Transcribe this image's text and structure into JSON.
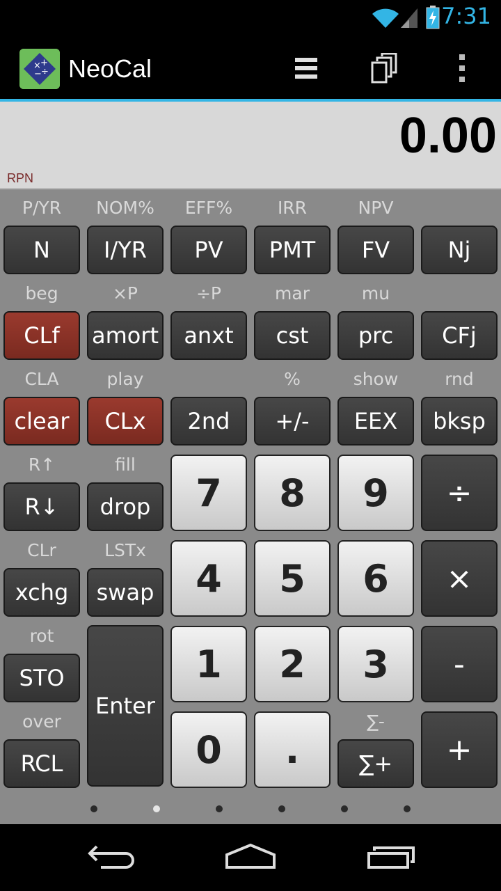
{
  "status_bar": {
    "time": "7:31"
  },
  "action_bar": {
    "title": "NeoCal"
  },
  "display": {
    "value": "0.00",
    "mode": "RPN"
  },
  "keys": [
    {
      "id": "n",
      "label": "N",
      "sub": "P/YR",
      "style": "dark"
    },
    {
      "id": "iyr",
      "label": "I/YR",
      "sub": "NOM%",
      "style": "dark"
    },
    {
      "id": "pv",
      "label": "PV",
      "sub": "EFF%",
      "style": "dark"
    },
    {
      "id": "pmt",
      "label": "PMT",
      "sub": "IRR",
      "style": "dark"
    },
    {
      "id": "fv",
      "label": "FV",
      "sub": "NPV",
      "style": "dark"
    },
    {
      "id": "nj",
      "label": "Nj",
      "sub": "",
      "style": "dark"
    },
    {
      "id": "clf",
      "label": "CLf",
      "sub": "beg",
      "style": "red"
    },
    {
      "id": "amort",
      "label": "amort",
      "sub": "×P",
      "style": "dark"
    },
    {
      "id": "anxt",
      "label": "anxt",
      "sub": "÷P",
      "style": "dark"
    },
    {
      "id": "cst",
      "label": "cst",
      "sub": "mar",
      "style": "dark"
    },
    {
      "id": "prc",
      "label": "prc",
      "sub": "mu",
      "style": "dark"
    },
    {
      "id": "cfj",
      "label": "CFj",
      "sub": "",
      "style": "dark"
    },
    {
      "id": "clear",
      "label": "clear",
      "sub": "CLA",
      "style": "red"
    },
    {
      "id": "clx",
      "label": "CLx",
      "sub": "play",
      "style": "red"
    },
    {
      "id": "2nd",
      "label": "2nd",
      "sub": "",
      "style": "dark"
    },
    {
      "id": "chs",
      "label": "+/-",
      "sub": "%",
      "style": "dark"
    },
    {
      "id": "eex",
      "label": "EEX",
      "sub": "show",
      "style": "dark"
    },
    {
      "id": "bksp",
      "label": "bksp",
      "sub": "rnd",
      "style": "dark"
    },
    {
      "id": "rdown",
      "label": "R↓",
      "sub": "R↑",
      "style": "dark"
    },
    {
      "id": "drop",
      "label": "drop",
      "sub": "fill",
      "style": "dark"
    },
    {
      "id": "xchg",
      "label": "xchg",
      "sub": "CLr",
      "style": "dark"
    },
    {
      "id": "swap",
      "label": "swap",
      "sub": "LSTx",
      "style": "dark"
    },
    {
      "id": "sto",
      "label": "STO",
      "sub": "rot",
      "style": "dark"
    },
    {
      "id": "rcl",
      "label": "RCL",
      "sub": "over",
      "style": "dark"
    },
    {
      "id": "enter",
      "label": "Enter",
      "sub": "",
      "style": "dark"
    },
    {
      "id": "7",
      "label": "7",
      "sub": "",
      "style": "light"
    },
    {
      "id": "8",
      "label": "8",
      "sub": "",
      "style": "light"
    },
    {
      "id": "9",
      "label": "9",
      "sub": "",
      "style": "light"
    },
    {
      "id": "div",
      "label": "÷",
      "sub": "",
      "style": "op"
    },
    {
      "id": "4",
      "label": "4",
      "sub": "",
      "style": "light"
    },
    {
      "id": "5",
      "label": "5",
      "sub": "",
      "style": "light"
    },
    {
      "id": "6",
      "label": "6",
      "sub": "",
      "style": "light"
    },
    {
      "id": "mul",
      "label": "×",
      "sub": "",
      "style": "op"
    },
    {
      "id": "1",
      "label": "1",
      "sub": "",
      "style": "light"
    },
    {
      "id": "2",
      "label": "2",
      "sub": "",
      "style": "light"
    },
    {
      "id": "3",
      "label": "3",
      "sub": "",
      "style": "light"
    },
    {
      "id": "sub",
      "label": "-",
      "sub": "",
      "style": "op"
    },
    {
      "id": "0",
      "label": "0",
      "sub": "",
      "style": "light"
    },
    {
      "id": "dot",
      "label": ".",
      "sub": "",
      "style": "light"
    },
    {
      "id": "sigma",
      "label": "∑+",
      "sub": "∑-",
      "style": "dark"
    },
    {
      "id": "add",
      "label": "+",
      "sub": "",
      "style": "op"
    }
  ],
  "pager": {
    "count": 6,
    "active": 1
  },
  "colors": {
    "accent": "#33b5e5",
    "key_red": "#8a3226",
    "keypad_bg": "#8a8a8a"
  }
}
